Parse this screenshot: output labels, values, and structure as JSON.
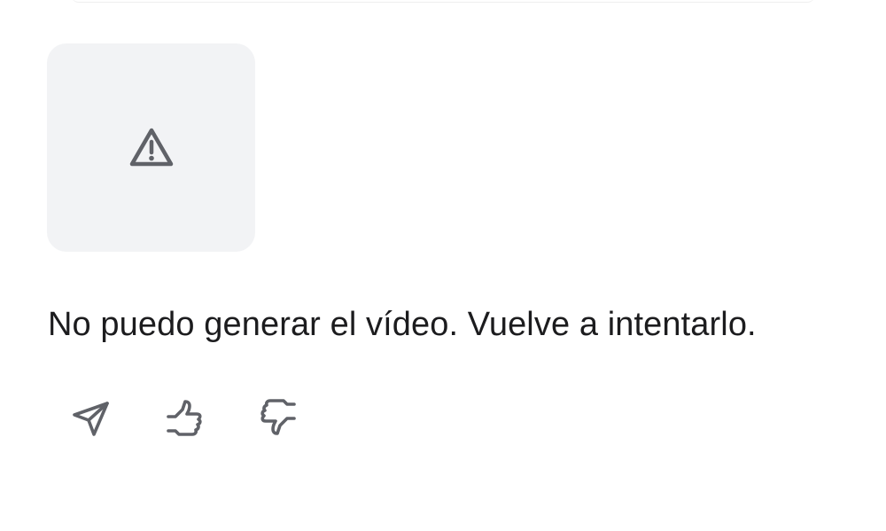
{
  "message": {
    "text": "No puedo generar el vídeo. Vuelve a intentarlo."
  },
  "media_card": {
    "icon": "warning-icon",
    "background": "#f2f3f5"
  },
  "actions": [
    {
      "icon": "send-icon"
    },
    {
      "icon": "thumbs-up-icon"
    },
    {
      "icon": "thumbs-down-icon"
    }
  ],
  "colors": {
    "icon": "#606268",
    "text": "#1c1c1e"
  }
}
